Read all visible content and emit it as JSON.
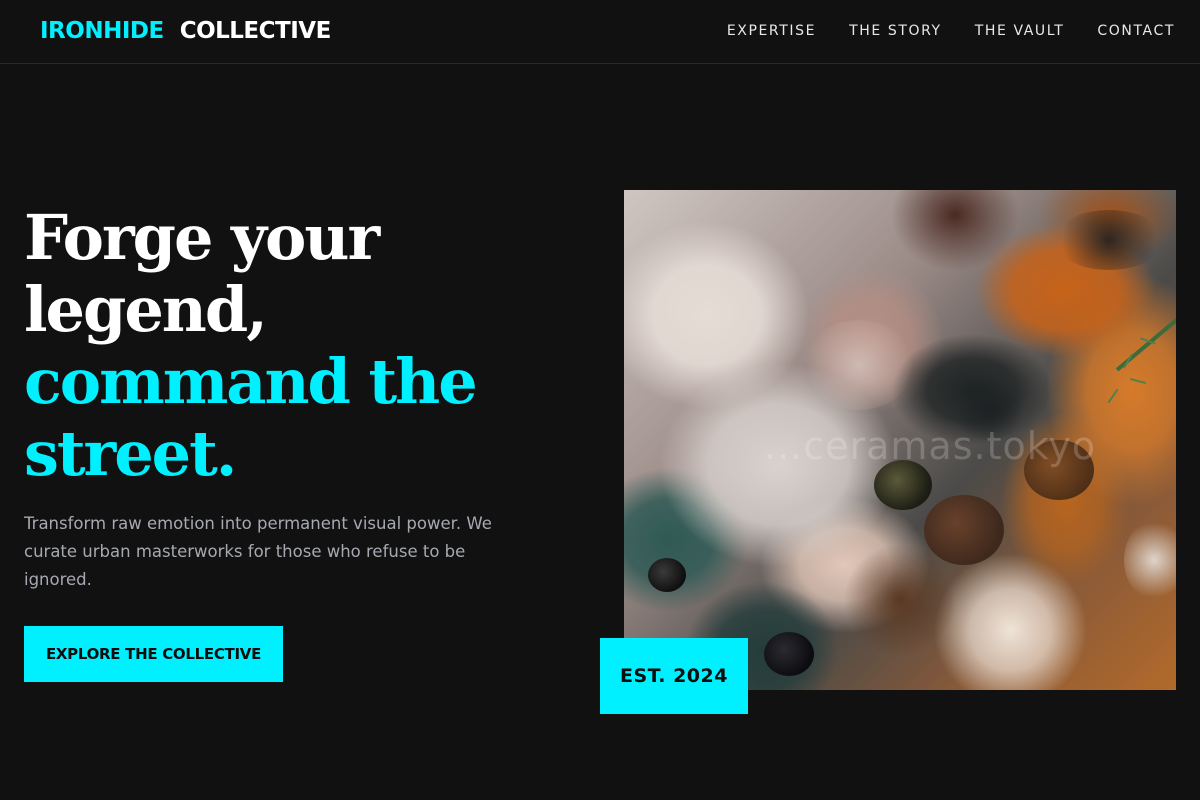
{
  "brand": {
    "name_part1": "IRONHIDE",
    "name_part2": "COLLECTIVE"
  },
  "nav": {
    "items": [
      {
        "label": "EXPERTISE"
      },
      {
        "label": "THE STORY"
      },
      {
        "label": "THE VAULT"
      },
      {
        "label": "CONTACT"
      }
    ]
  },
  "hero": {
    "heading_lines": [
      {
        "text": "Forge your",
        "color": "white"
      },
      {
        "text": "legend,",
        "color": "white"
      },
      {
        "text": "command the",
        "color": "cyan"
      },
      {
        "text": "street.",
        "color": "cyan"
      }
    ],
    "description": "Transform raw emotion into permanent visual power. We curate urban masterworks for those who refuse to be ignored.",
    "cta_label": "EXPLORE THE COLLECTIVE",
    "badge": "EST. 2024",
    "image_watermark": "...ceramas.tokyo"
  },
  "colors": {
    "background": "#111112",
    "accent": "#00f0ff",
    "text_primary": "#ffffff",
    "text_muted": "#a7a9b1"
  },
  "icons": {
    "artwork": "abstract-impasto-painting"
  }
}
